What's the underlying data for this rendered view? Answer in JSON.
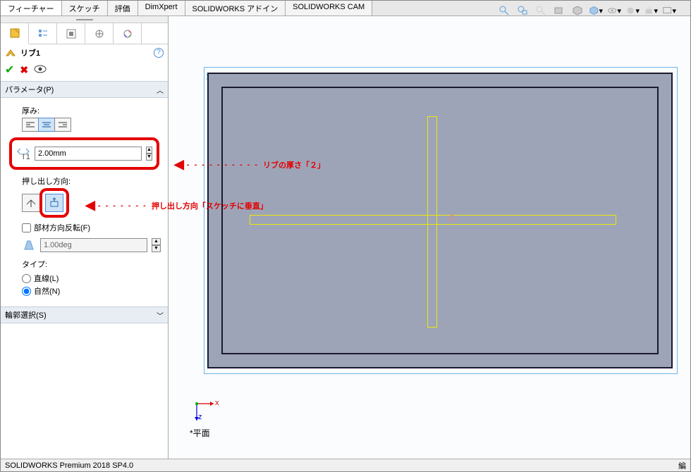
{
  "tabs": [
    "フィーチャー",
    "スケッチ",
    "評価",
    "DimXpert",
    "SOLIDWORKS アドイン",
    "SOLIDWORKS CAM"
  ],
  "active_tab": 0,
  "feature": {
    "name": "リブ1",
    "help_tooltip": "?"
  },
  "sections": {
    "params_header": "パラメータ(P)",
    "thickness_label": "厚み:",
    "thickness_value": "2.00mm",
    "extrude_dir_label": "押し出し方向:",
    "flip_material_label": "部材方向反転(F)",
    "draft_value": "1.00deg",
    "type_label": "タイプ:",
    "type_options": {
      "line": "直線(L)",
      "natural": "自然(N)"
    },
    "type_selected": "natural",
    "contour_header": "輪郭選択(S)"
  },
  "annotations": {
    "thickness": "リブの厚さ「２」",
    "direction": "押し出し方向「スケッチに垂直」"
  },
  "viewport": {
    "plane_label": "平面",
    "triad_plane": "*平面",
    "axes": {
      "x": "x",
      "z": "z"
    }
  },
  "status": {
    "product": "SOLIDWORKS Premium 2018 SP4.0",
    "right": "編"
  }
}
